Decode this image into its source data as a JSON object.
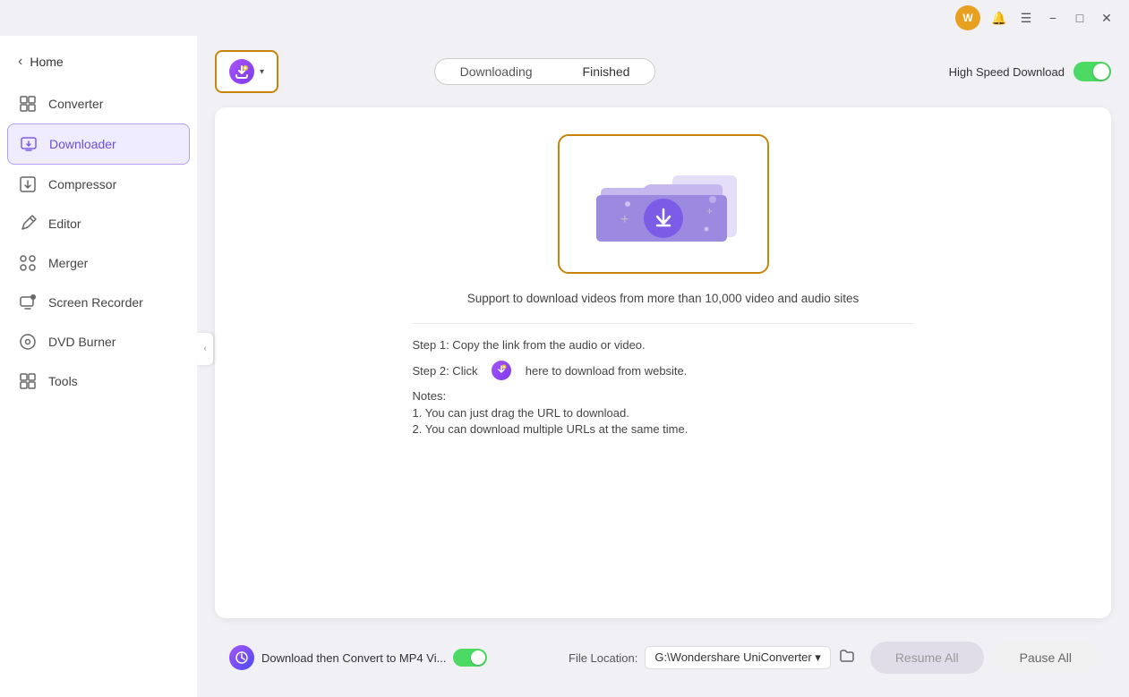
{
  "titlebar": {
    "avatar_initial": "W",
    "bell_icon": "🔔",
    "menu_icon": "☰",
    "minimize_icon": "−",
    "maximize_icon": "□",
    "close_icon": "✕"
  },
  "sidebar": {
    "back_label": "Home",
    "items": [
      {
        "id": "converter",
        "label": "Converter",
        "icon": "⊞"
      },
      {
        "id": "downloader",
        "label": "Downloader",
        "icon": "⊟",
        "active": true
      },
      {
        "id": "compressor",
        "label": "Compressor",
        "icon": "⊡"
      },
      {
        "id": "editor",
        "label": "Editor",
        "icon": "✂"
      },
      {
        "id": "merger",
        "label": "Merger",
        "icon": "⧩"
      },
      {
        "id": "screen-recorder",
        "label": "Screen Recorder",
        "icon": "⊙"
      },
      {
        "id": "dvd-burner",
        "label": "DVD Burner",
        "icon": "◉"
      },
      {
        "id": "tools",
        "label": "Tools",
        "icon": "⊞"
      }
    ]
  },
  "toolbar": {
    "add_button_label": "▾",
    "tab_downloading": "Downloading",
    "tab_finished": "Finished",
    "high_speed_label": "High Speed Download"
  },
  "content": {
    "support_text": "Support to download videos from more than 10,000 video and audio sites",
    "step1": "Step 1: Copy the link from the audio or video.",
    "step2_prefix": "Step 2: Click",
    "step2_suffix": "here to download from website.",
    "notes_title": "Notes:",
    "note1": "1. You can just drag the URL to download.",
    "note2": "2. You can download multiple URLs at the same time."
  },
  "bottom": {
    "convert_label": "Download then Convert to MP4 Vi...",
    "file_location_label": "File Location:",
    "file_location_value": "G:\\Wondershare UniConverter ▾",
    "resume_label": "Resume All",
    "pause_label": "Pause All"
  }
}
